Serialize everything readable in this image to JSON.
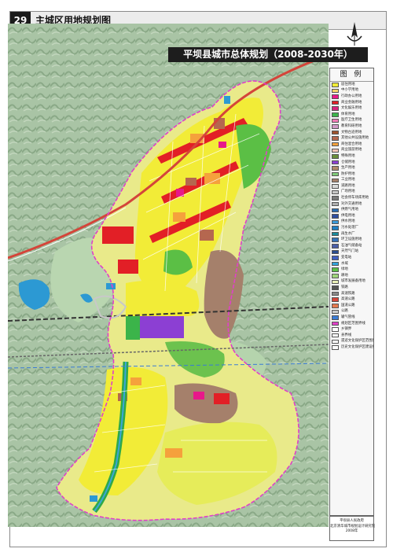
{
  "header": {
    "page_number": "29",
    "title": "主城区用地规划图"
  },
  "banner": {
    "title": "平坝县城市总体规划",
    "period": "（2008-2030年）"
  },
  "legend": {
    "title": "图 例",
    "items": [
      {
        "label": "居住用地",
        "color": "#f2ec37"
      },
      {
        "label": "中小学用地",
        "color": "#f6d26b"
      },
      {
        "label": "行政办公用地",
        "color": "#e8188a"
      },
      {
        "label": "商业金融用地",
        "color": "#e21f26"
      },
      {
        "label": "文化娱乐用地",
        "color": "#d8257e"
      },
      {
        "label": "体育用地",
        "color": "#3bb44a"
      },
      {
        "label": "医疗卫生用地",
        "color": "#f07ab4"
      },
      {
        "label": "教育科研用地",
        "color": "#d19ac6"
      },
      {
        "label": "文物古迹用地",
        "color": "#a0522d"
      },
      {
        "label": "其他公共设施用地",
        "color": "#b5674f"
      },
      {
        "label": "商住混合用地",
        "color": "#f5a13c"
      },
      {
        "label": "商业旅游用地",
        "color": "#f4c3b6"
      },
      {
        "label": "特殊用地",
        "color": "#6b8e3a"
      },
      {
        "label": "仓储用地",
        "color": "#8c3fd3"
      },
      {
        "label": "生产用地",
        "color": "#b08a6a"
      },
      {
        "label": "防护用地",
        "color": "#7fcb7a"
      },
      {
        "label": "工业用地",
        "color": "#a5806b"
      },
      {
        "label": "道路用地",
        "color": "#d8d8d8"
      },
      {
        "label": "广场用地",
        "color": "#c7c7c7"
      },
      {
        "label": "社会停车场库用地",
        "color": "#7a7a7a"
      },
      {
        "label": "对外交通用地",
        "color": "#b0b0b0"
      },
      {
        "label": "供燃气用地",
        "color": "#2a6db3"
      },
      {
        "label": "供电用地",
        "color": "#2e4ea0"
      },
      {
        "label": "供水用地",
        "color": "#3b9ad9"
      },
      {
        "label": "污水处理厂",
        "color": "#1f7fc4"
      },
      {
        "label": "再生水厂",
        "color": "#1a8a9c"
      },
      {
        "label": "环卫设施用地",
        "color": "#3572b8"
      },
      {
        "label": "石油气储备站",
        "color": "#4a5fa8"
      },
      {
        "label": "天然气门站",
        "color": "#2a4d8f"
      },
      {
        "label": "变电站",
        "color": "#3f5fbf"
      },
      {
        "label": "水域",
        "color": "#33a3dc"
      },
      {
        "label": "绿地",
        "color": "#5bbf45"
      },
      {
        "label": "耕地",
        "color": "#9ed47a"
      },
      {
        "label": "城市发展备用地",
        "color": "#eaf0b8"
      },
      {
        "label": "铁路",
        "color": "#555555"
      },
      {
        "label": "高速铁路",
        "color": "#888888"
      },
      {
        "label": "高速公路",
        "color": "#d4453a"
      },
      {
        "label": "国道公路",
        "color": "#e57a4f"
      },
      {
        "label": "公路",
        "color": "#c8c8c8"
      },
      {
        "label": "输气管线",
        "color": "#3a7bd5"
      },
      {
        "label": "规划区范围界线",
        "color": "#e040c8"
      },
      {
        "label": "乡镇界",
        "color": "#ffffff"
      },
      {
        "label": "县界线",
        "color": "#ffffff"
      },
      {
        "label": "遗迹文化保护区范围界线",
        "color": "#ffffff"
      },
      {
        "label": "历史文化保护区建设控制地带界线",
        "color": "#ffffff"
      }
    ]
  },
  "credit": {
    "line1": "平坝县人民政府",
    "line2": "北京清华城市规划设计研究院",
    "line3": "2008年"
  },
  "colors": {
    "relief": "#a8c3a4",
    "boundary": "#e040c8",
    "highway": "#d4453a"
  }
}
